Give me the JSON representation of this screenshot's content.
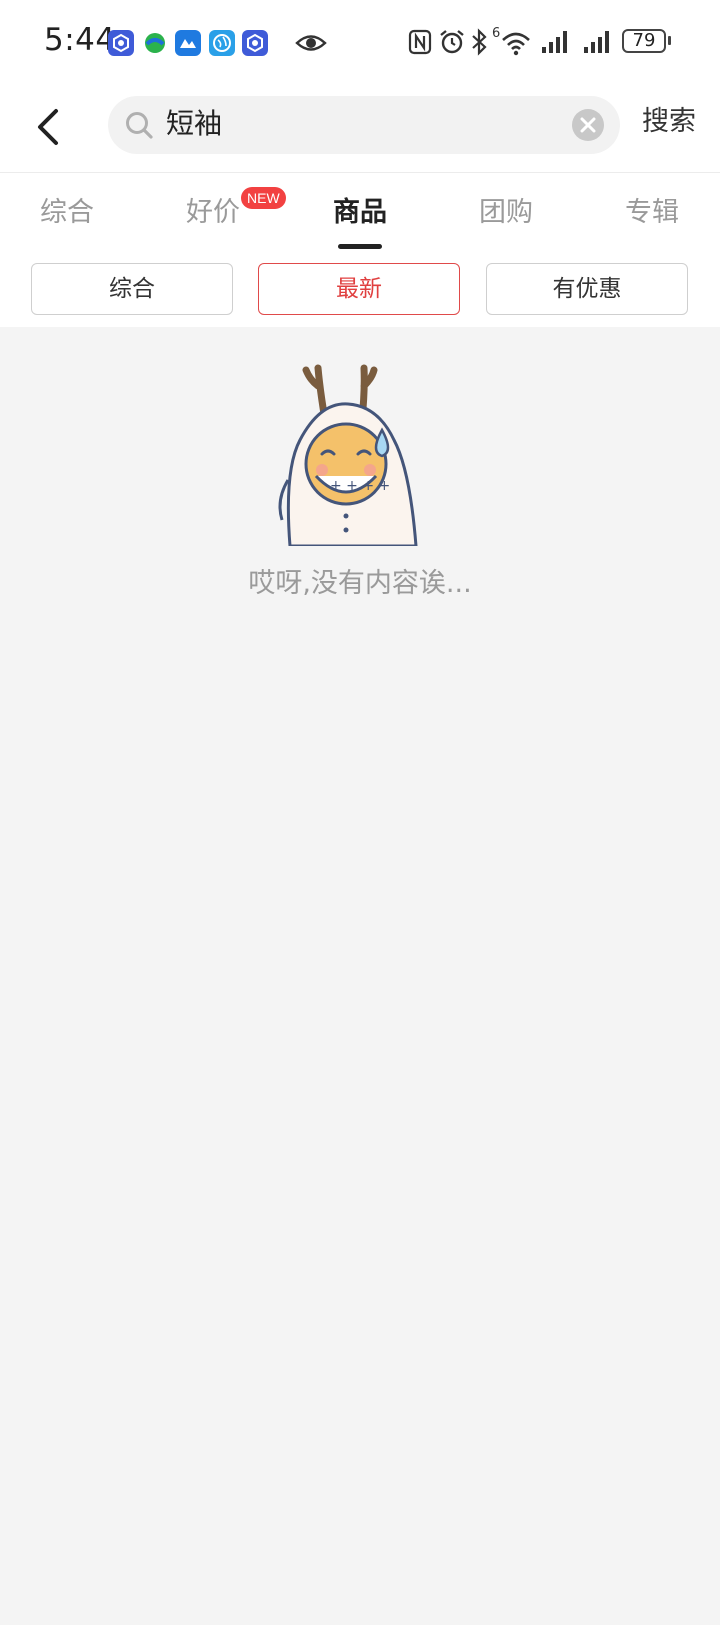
{
  "status_bar": {
    "time": "5:44",
    "battery": "79",
    "network_label": "6"
  },
  "search": {
    "query": "短袖",
    "button_label": "搜索"
  },
  "tabs": [
    {
      "label": "综合"
    },
    {
      "label": "好价",
      "badge": "NEW"
    },
    {
      "label": "商品",
      "active": true
    },
    {
      "label": "团购"
    },
    {
      "label": "专辑"
    }
  ],
  "filters": [
    {
      "label": "综合"
    },
    {
      "label": "最新",
      "active": true
    },
    {
      "label": "有优惠"
    }
  ],
  "empty_state": {
    "message": "哎呀,没有内容诶..."
  },
  "colors": {
    "accent": "#e04040",
    "badge": "#f24141",
    "background": "#f4f4f4"
  }
}
